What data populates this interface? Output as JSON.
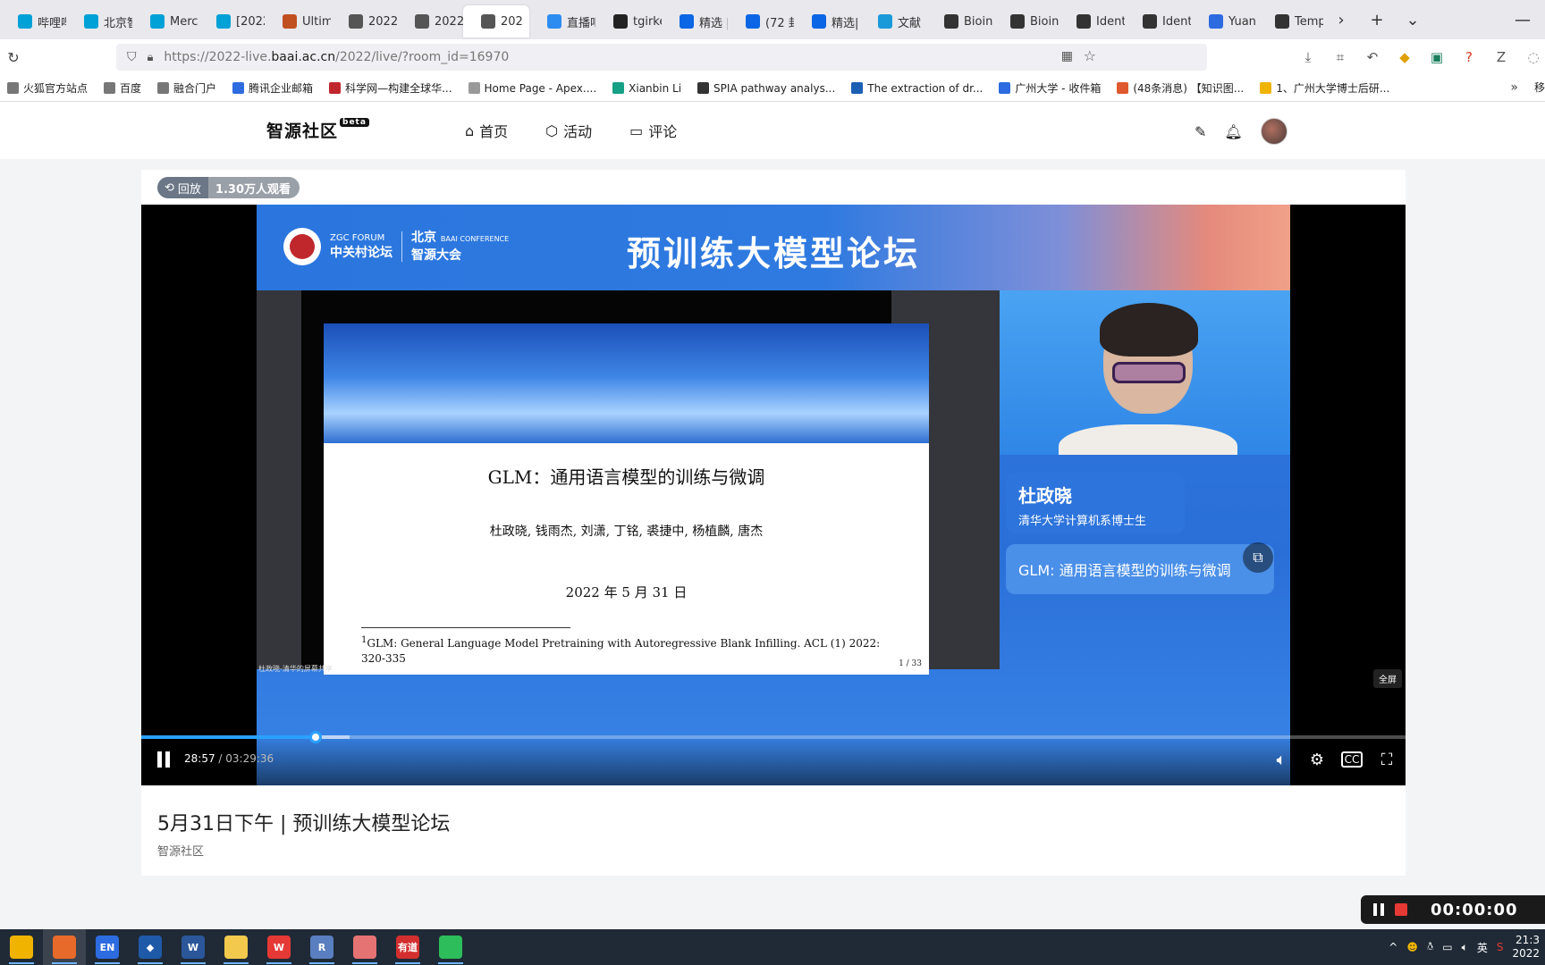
{
  "browser": {
    "tabs": [
      {
        "label": "哔哩哔",
        "color": "#00a1d6"
      },
      {
        "label": "北京智",
        "color": "#00a1d6"
      },
      {
        "label": "Merc",
        "color": "#00a1d6"
      },
      {
        "label": "[2022",
        "color": "#00a1d6"
      },
      {
        "label": "Ultim",
        "color": "#c05020"
      },
      {
        "label": "2022",
        "color": "#555555"
      },
      {
        "label": "2022",
        "color": "#555555"
      },
      {
        "label": "202",
        "color": "#555555",
        "active": true
      },
      {
        "label": "直播吧",
        "color": "#2d8cf0"
      },
      {
        "label": "tgirke",
        "color": "#222222"
      },
      {
        "label": "精选 |",
        "color": "#0a66e4"
      },
      {
        "label": "(72 封",
        "color": "#0a66e4"
      },
      {
        "label": "精选|",
        "color": "#0a66e4"
      },
      {
        "label": "文献",
        "color": "#1a9ad9"
      },
      {
        "label": "Bioinf",
        "color": "#333333"
      },
      {
        "label": "Bioinf",
        "color": "#333333"
      },
      {
        "label": "Identi",
        "color": "#333333"
      },
      {
        "label": "Identi",
        "color": "#333333"
      },
      {
        "label": "Yuan",
        "color": "#2d6be0"
      },
      {
        "label": "Temp",
        "color": "#333333"
      }
    ],
    "url_prefix": "https://2022-live.",
    "url_domain": "baai.ac.cn",
    "url_path": "/2022/live/?room_id=16970",
    "bookmarks": [
      {
        "label": "火狐官方站点",
        "color": "#777777"
      },
      {
        "label": "百度",
        "color": "#777777"
      },
      {
        "label": "融合门户",
        "color": "#777777"
      },
      {
        "label": "腾讯企业邮箱",
        "color": "#2d6be0"
      },
      {
        "label": "科学网—构建全球华...",
        "color": "#c0272d"
      },
      {
        "label": "Home Page - Apex....",
        "color": "#999999"
      },
      {
        "label": "Xianbin Li",
        "color": "#16a085"
      },
      {
        "label": "SPIA pathway analys...",
        "color": "#333333"
      },
      {
        "label": "The extraction of dr...",
        "color": "#1a5fb4"
      },
      {
        "label": "广州大学 - 收件箱",
        "color": "#2d6be0"
      },
      {
        "label": "(48条消息) 【知识图...",
        "color": "#e0582d"
      },
      {
        "label": "1、广州大学博士后研...",
        "color": "#f0b400"
      }
    ],
    "bookmark_overflow": "移"
  },
  "site": {
    "logo": "智源社区",
    "logo_badge": "beta",
    "nav": [
      {
        "label": "首页",
        "icon": "home-icon"
      },
      {
        "label": "活动",
        "icon": "cube-icon"
      },
      {
        "label": "评论",
        "icon": "comment-icon"
      }
    ]
  },
  "player": {
    "replay_label": "回放",
    "views": "1.30万人观看",
    "banner_org_en": "ZGC FORUM",
    "banner_org_cn": "中关村论坛",
    "banner_conf_cn1": "北京",
    "banner_conf_en": "BAAI CONFERENCE",
    "banner_conf_cn2": "智源大会",
    "banner_title": "预训练大模型论坛",
    "slide_title": "GLM：通用语言模型的训练与微调",
    "slide_authors": "杜政晓, 钱雨杰, 刘潇, 丁铭, 裘捷中, 杨植麟, 唐杰",
    "slide_date": "2022 年 5 月 31 日",
    "slide_footnote_mark": "1",
    "slide_footnote": "GLM: General Language Model Pretraining with Autoregressive Blank Infilling. ACL (1) 2022: 320-335",
    "slide_page": "1 / 33",
    "share_tag": "杜政晓-清华的屏幕共享",
    "speaker_name": "杜政晓",
    "speaker_title": "清华大学计算机系博士生",
    "talk_topic": "GLM: 通用语言模型的训练与微调",
    "fullscreen_tip": "全屏",
    "current_time": "28:57",
    "duration": "03:29:36",
    "progress_played": 0.1381,
    "progress_buffered": 0.1645,
    "accent_color": "#2aa0ff"
  },
  "video": {
    "title": "5月31日下午 | 预训练大模型论坛",
    "channel": "智源社区"
  },
  "recorder": {
    "time": "00:00:00"
  },
  "taskbar": {
    "apps": [
      {
        "name": "file-explorer-icon",
        "color": "#f0b400",
        "label": ""
      },
      {
        "name": "firefox-icon",
        "color": "#e86a2a",
        "label": "",
        "active": true
      },
      {
        "name": "input-method-icon",
        "color": "#2d6be0",
        "label": "EN"
      },
      {
        "name": "code-editor-icon",
        "color": "#1e5aa8",
        "label": "◆"
      },
      {
        "name": "word-icon",
        "color": "#2b579a",
        "label": "W"
      },
      {
        "name": "chrome-icon",
        "color": "#f2c94c",
        "label": ""
      },
      {
        "name": "wps-icon",
        "color": "#e53935",
        "label": "W"
      },
      {
        "name": "r-icon",
        "color": "#5a7fc0",
        "label": "R"
      },
      {
        "name": "sticky-icon",
        "color": "#e57373",
        "label": ""
      },
      {
        "name": "youdao-icon",
        "color": "#d32f2f",
        "label": "有道"
      },
      {
        "name": "wechat-icon",
        "color": "#2dbd5a",
        "label": ""
      }
    ],
    "ime": "英",
    "clock_time": "21:3",
    "clock_date": "2022"
  }
}
